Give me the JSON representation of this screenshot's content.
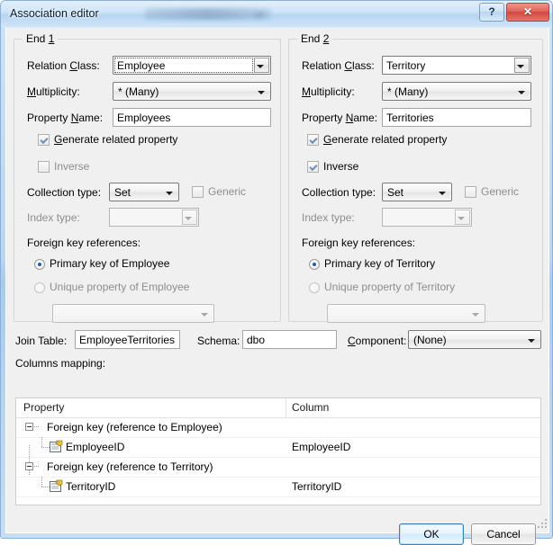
{
  "window": {
    "title": "Association editor",
    "help_button": "?",
    "close_button": "✕"
  },
  "end1": {
    "group_title": "End 1",
    "relation_class_label": "Relation Class:",
    "relation_class_value": "Employee",
    "multiplicity_label": "Multiplicity:",
    "multiplicity_value": "* (Many)",
    "property_name_label": "Property Name:",
    "property_name_value": "Employees",
    "generate_related_property_label": "Generate related property",
    "inverse_label": "Inverse",
    "collection_type_label": "Collection type:",
    "collection_type_value": "Set",
    "generic_label": "Generic",
    "index_type_label": "Index type:",
    "index_type_value": "",
    "foreign_key_references_label": "Foreign key references:",
    "primary_key_label": "Primary key of Employee",
    "unique_property_label": "Unique property of Employee",
    "unique_property_value": ""
  },
  "end2": {
    "group_title": "End 2",
    "relation_class_label": "Relation Class:",
    "relation_class_value": "Territory",
    "multiplicity_label": "Multiplicity:",
    "multiplicity_value": "* (Many)",
    "property_name_label": "Property Name:",
    "property_name_value": "Territories",
    "generate_related_property_label": "Generate related property",
    "inverse_label": "Inverse",
    "collection_type_label": "Collection type:",
    "collection_type_value": "Set",
    "generic_label": "Generic",
    "index_type_label": "Index type:",
    "index_type_value": "",
    "foreign_key_references_label": "Foreign key references:",
    "primary_key_label": "Primary key of Territory",
    "unique_property_label": "Unique property of Territory",
    "unique_property_value": ""
  },
  "join": {
    "join_table_label": "Join Table:",
    "join_table_value": "EmployeeTerritories",
    "schema_label": "Schema:",
    "schema_value": "dbo",
    "component_label": "Component:",
    "component_value": "(None)"
  },
  "mapping": {
    "section_label": "Columns mapping:",
    "headers": [
      "Property",
      "Column"
    ],
    "rows": [
      {
        "property": "Foreign key (reference to Employee)",
        "column": "",
        "type": "group"
      },
      {
        "property": "EmployeeID",
        "column": "EmployeeID",
        "type": "item"
      },
      {
        "property": "Foreign key (reference to Territory)",
        "column": "",
        "type": "group"
      },
      {
        "property": "TerritoryID",
        "column": "TerritoryID",
        "type": "item"
      }
    ]
  },
  "footer": {
    "ok_label": "OK",
    "cancel_label": "Cancel"
  },
  "colors": {
    "accent": "#3c7fb1",
    "close_button": "#cf4a40",
    "titlebar": "#b7d5f0",
    "client_bg": "#f0f0f0",
    "radio_dot": "#1f5fa8",
    "check_mark": "#6b8fb5"
  }
}
